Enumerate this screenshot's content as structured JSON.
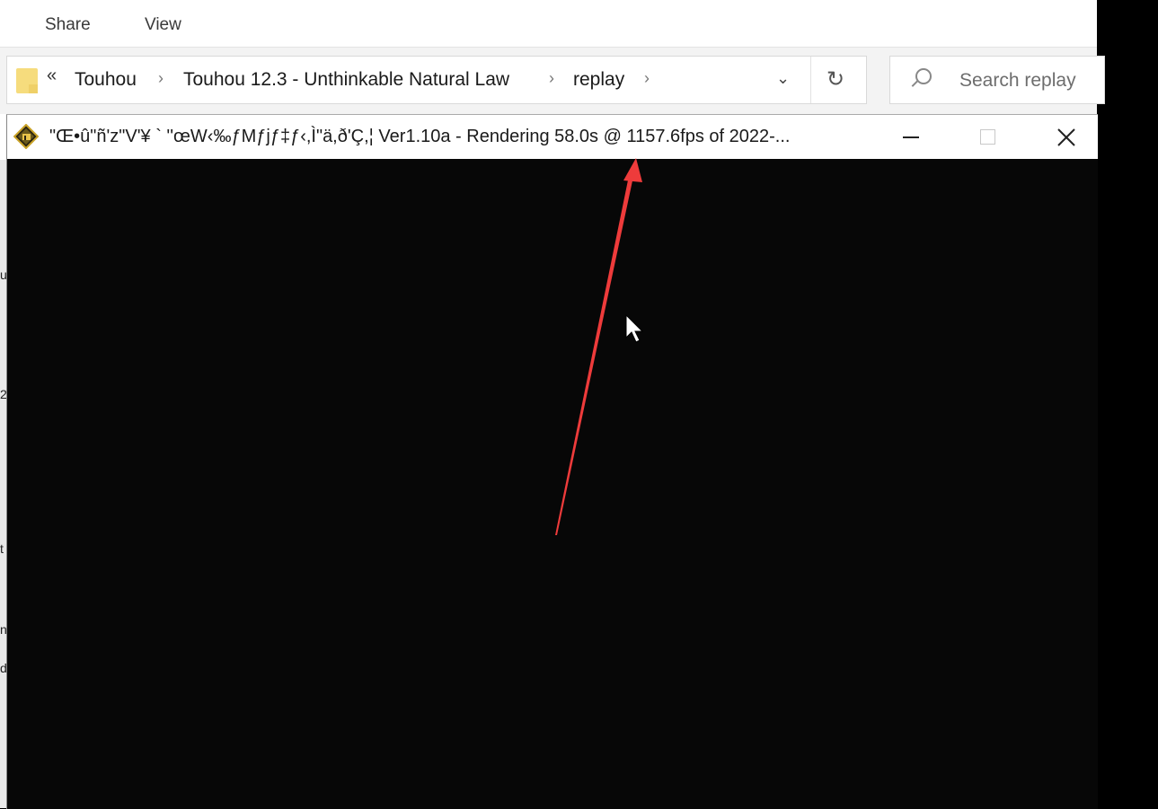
{
  "explorer": {
    "ribbon_tabs": [
      "Share",
      "View"
    ],
    "address_bar": {
      "overflow": "«",
      "breadcrumbs": [
        "Touhou",
        "Touhou 12.3 - Unthinkable Natural Law",
        "replay"
      ],
      "separator": "›",
      "dropdown_icon": "chevron-down-icon",
      "dropdown_glyph": "⌄",
      "refresh_glyph": "↻"
    },
    "search": {
      "placeholder": "Search replay"
    },
    "left_edge_glyphs": [
      "u",
      "2",
      "t",
      "n",
      "d"
    ]
  },
  "game_window": {
    "title": "\"Œ•û\"ñ'z\"V'¥ ` ''œW‹‰ƒMƒjƒ‡ƒ‹,Ì\"ä,ð'Ç,¦ Ver1.10a - Rendering 58.0s @ 1157.6fps of 2022-...",
    "icon": "touhou-app-icon",
    "controls": {
      "minimize": "minimize-icon",
      "maximize": "maximize-icon",
      "close_glyph": "✕"
    }
  },
  "annotation": {
    "type": "arrow",
    "color": "#ee3b3b",
    "target": "rendering-time-in-title"
  },
  "colors": {
    "canvas_bg": "#070707",
    "titlebar_bg": "#ffffff",
    "folder": "#f6dc7d"
  }
}
